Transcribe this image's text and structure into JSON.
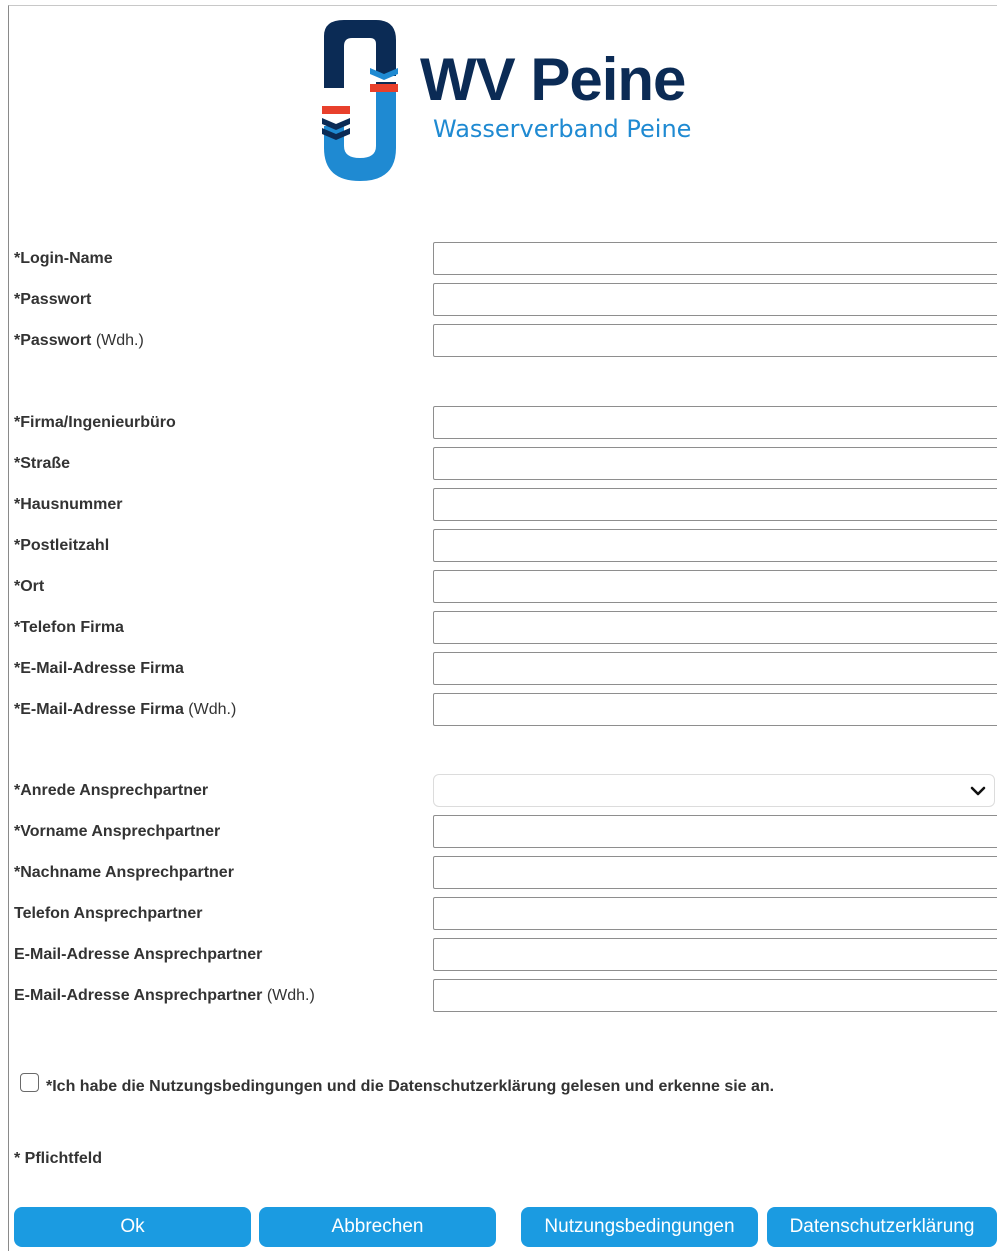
{
  "logo": {
    "title": "WV Peine",
    "subtitle": "Wasserverband Peine",
    "colors": {
      "navy": "#0b2b55",
      "blue": "#1f8ad2",
      "red": "#e8402c"
    }
  },
  "form": {
    "account": [
      {
        "label": "*Login-Name",
        "value": ""
      },
      {
        "label": "*Passwort",
        "value": ""
      },
      {
        "label": "*Passwort",
        "suffix": " (Wdh.)",
        "value": ""
      }
    ],
    "company": [
      {
        "label": "*Firma/Ingenieurbüro",
        "value": ""
      },
      {
        "label": "*Straße",
        "value": ""
      },
      {
        "label": "*Hausnummer",
        "value": ""
      },
      {
        "label": "*Postleitzahl",
        "value": ""
      },
      {
        "label": "*Ort",
        "value": ""
      },
      {
        "label": "*Telefon Firma",
        "value": ""
      },
      {
        "label": "*E-Mail-Adresse Firma",
        "value": ""
      },
      {
        "label": "*E-Mail-Adresse Firma",
        "suffix": " (Wdh.)",
        "value": ""
      }
    ],
    "contact": {
      "salutation": {
        "label": "*Anrede Ansprechpartner",
        "selected": ""
      },
      "fields": [
        {
          "label": "*Vorname Ansprechpartner",
          "value": ""
        },
        {
          "label": "*Nachname Ansprechpartner",
          "value": ""
        },
        {
          "label": "Telefon Ansprechpartner",
          "value": ""
        },
        {
          "label": "E-Mail-Adresse Ansprechpartner",
          "value": ""
        },
        {
          "label": "E-Mail-Adresse Ansprechpartner",
          "suffix": " (Wdh.)",
          "value": ""
        }
      ]
    },
    "consent": {
      "text": "*Ich habe die Nutzungsbedingungen und die Datenschutzerklärung gelesen und erkenne sie an.",
      "checked": false
    },
    "required_note": "* Pflichtfeld"
  },
  "buttons": {
    "ok": "Ok",
    "cancel": "Abbrechen",
    "terms": "Nutzungsbedingungen",
    "privacy": "Datenschutzerklärung",
    "color": "#1b9be1"
  }
}
